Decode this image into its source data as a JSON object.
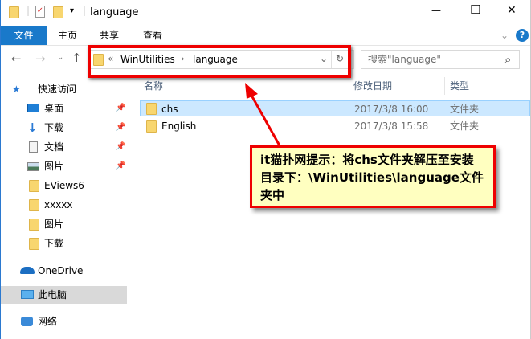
{
  "window": {
    "title": "language",
    "minimize": "—",
    "maximize": "☐",
    "close": "✕"
  },
  "ribbon": {
    "tabs": [
      "文件",
      "主页",
      "共享",
      "查看"
    ],
    "help": "?",
    "expand": "⌄"
  },
  "nav": {
    "back": "←",
    "forward": "→",
    "recent": "⌄",
    "up": "↑"
  },
  "address": {
    "overflow": "«",
    "crumbs": [
      "WinUtilities",
      "language"
    ],
    "sep": "›",
    "dropdown": "⌄",
    "refresh": "↻"
  },
  "search": {
    "placeholder": "搜索\"language\"",
    "icon": "⌕"
  },
  "sidebar": {
    "quick_access": "快速访问",
    "items": [
      {
        "label": "桌面",
        "pinned": true
      },
      {
        "label": "下载",
        "pinned": true
      },
      {
        "label": "文档",
        "pinned": true
      },
      {
        "label": "图片",
        "pinned": true
      },
      {
        "label": "EViews6"
      },
      {
        "label": "xxxxx"
      },
      {
        "label": "图片"
      },
      {
        "label": "下载"
      }
    ],
    "onedrive": "OneDrive",
    "this_pc": "此电脑",
    "network": "网络",
    "pin_glyph": "📌"
  },
  "columns": {
    "name": "名称",
    "modified": "修改日期",
    "type": "类型"
  },
  "files": [
    {
      "name": "chs",
      "modified": "2017/3/8 16:00",
      "type": "文件夹",
      "selected": true
    },
    {
      "name": "English",
      "modified": "2017/3/8 15:58",
      "type": "文件夹"
    }
  ],
  "annotation": {
    "text": "it猫扑网提示：将chs文件夹解压至安装目录下：\\WinUtilities\\language文件夹中",
    "border_color": "#e00000",
    "fill": "#ffffc0"
  }
}
